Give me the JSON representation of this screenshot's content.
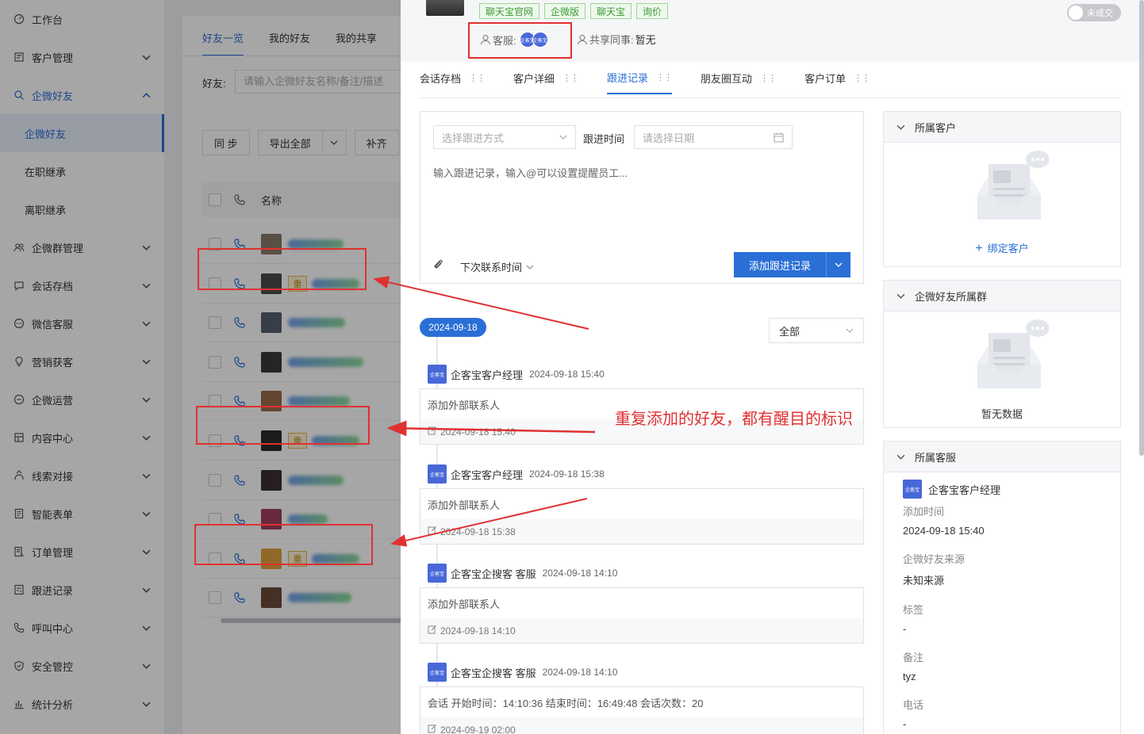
{
  "sidebar": {
    "items": [
      {
        "label": "工作台",
        "icon": "dashboard-icon",
        "arrow": false
      },
      {
        "label": "客户管理",
        "icon": "customer-icon",
        "arrow": true
      },
      {
        "label": "企微好友",
        "icon": "search-person-icon",
        "arrow": true,
        "expanded": true
      },
      {
        "label": "企微群管理",
        "icon": "group-icon",
        "arrow": true
      },
      {
        "label": "会话存档",
        "icon": "chat-icon",
        "arrow": true
      },
      {
        "label": "微信客服",
        "icon": "service-icon",
        "arrow": true
      },
      {
        "label": "营销获客",
        "icon": "bulb-icon",
        "arrow": true
      },
      {
        "label": "企微运营",
        "icon": "operate-icon",
        "arrow": true
      },
      {
        "label": "内容中心",
        "icon": "content-icon",
        "arrow": true
      },
      {
        "label": "线索对接",
        "icon": "lead-icon",
        "arrow": true
      },
      {
        "label": "智能表单",
        "icon": "form-icon",
        "arrow": true
      },
      {
        "label": "订单管理",
        "icon": "order-icon",
        "arrow": true
      },
      {
        "label": "跟进记录",
        "icon": "record-icon",
        "arrow": true
      },
      {
        "label": "呼叫中心",
        "icon": "call-icon",
        "arrow": true
      },
      {
        "label": "安全管控",
        "icon": "shield-icon",
        "arrow": true
      },
      {
        "label": "统计分析",
        "icon": "chart-icon",
        "arrow": true
      }
    ],
    "subitems": [
      "企微好友",
      "在职继承",
      "离职继承"
    ]
  },
  "list": {
    "tabs": [
      "好友一览",
      "我的好友",
      "我的共享"
    ],
    "filter_label": "好友:",
    "filter_placeholder": "请输入企微好友名称/备注/描述",
    "buttons": {
      "sync": "同 步",
      "export": "导出全部",
      "fill": "补齐"
    },
    "col_name": "名称",
    "dup_tag": "重",
    "rows": [
      {
        "dup": false,
        "avatar": "#8a7a6a"
      },
      {
        "dup": true,
        "avatar": "#4a4a4a"
      },
      {
        "dup": false,
        "avatar": "#556070"
      },
      {
        "dup": false,
        "avatar": "#3a3a3a"
      },
      {
        "dup": false,
        "avatar": "#9a6a4a"
      },
      {
        "dup": true,
        "avatar": "#2a2a2a"
      },
      {
        "dup": false,
        "avatar": "#3a3030"
      },
      {
        "dup": false,
        "avatar": "#a04060"
      },
      {
        "dup": true,
        "avatar": "#e0a040"
      },
      {
        "dup": false,
        "avatar": "#6a4a3a"
      }
    ]
  },
  "drawer": {
    "tags": [
      "聊天宝官网",
      "企微版",
      "聊天宝",
      "询价"
    ],
    "kefu_label": "客服:",
    "kefu_avatar_text": "企客宝",
    "share_label": "共享同事:",
    "share_value": "暂无",
    "toggle_label": "未成交",
    "tabs": [
      "会话存档",
      "客户详细",
      "跟进记录",
      "朋友圈互动",
      "客户订单"
    ],
    "active_tab": 2,
    "composer": {
      "method_placeholder": "选择跟进方式",
      "time_label": "跟进时间",
      "date_placeholder": "请选择日期",
      "text_placeholder": "输入跟进记录，输入@可以设置提醒员工...",
      "next_contact": "下次联系时间",
      "add_button": "添加跟进记录"
    },
    "date_pill": "2024-09-18",
    "filter_all": "全部",
    "logo_text": "企客宝",
    "entries": [
      {
        "author": "企客宝客户经理",
        "time": "2024-09-18 15:40",
        "content": "添加外部联系人",
        "edited": "2024-09-18 15:40"
      },
      {
        "author": "企客宝客户经理",
        "time": "2024-09-18 15:38",
        "content": "添加外部联系人",
        "edited": "2024-09-18 15:38"
      },
      {
        "author": "企客宝企搜客 客服",
        "time": "2024-09-18 14:10",
        "content": "添加外部联系人",
        "edited": "2024-09-18 14:10"
      },
      {
        "author": "企客宝企搜客 客服",
        "time": "2024-09-18 14:10",
        "content": "会话  开始时间：14:10:36  结束时间：16:49:48  会话次数：20",
        "edited": "2024-09-19 02:00"
      }
    ],
    "annotation": "重复添加的好友，都有醒目的标识"
  },
  "panels": {
    "customer": {
      "title": "所属客户",
      "action": "绑定客户"
    },
    "groups": {
      "title": "企微好友所属群",
      "empty": "暂无数据"
    },
    "service": {
      "title": "所属客服",
      "name": "企客宝客户经理",
      "fields": [
        {
          "k": "添加时间",
          "v": "2024-09-18 15:40"
        },
        {
          "k": "企微好友来源",
          "v": "未知来源"
        },
        {
          "k": "标签",
          "v": "-"
        },
        {
          "k": "备注",
          "v": "tyz"
        },
        {
          "k": "电话",
          "v": "-"
        }
      ]
    }
  },
  "colors": {
    "primary": "#2a6fd6",
    "annotation": "#e03131",
    "tag_green": "#3c9a36",
    "dup_tag": "#c08a14"
  }
}
